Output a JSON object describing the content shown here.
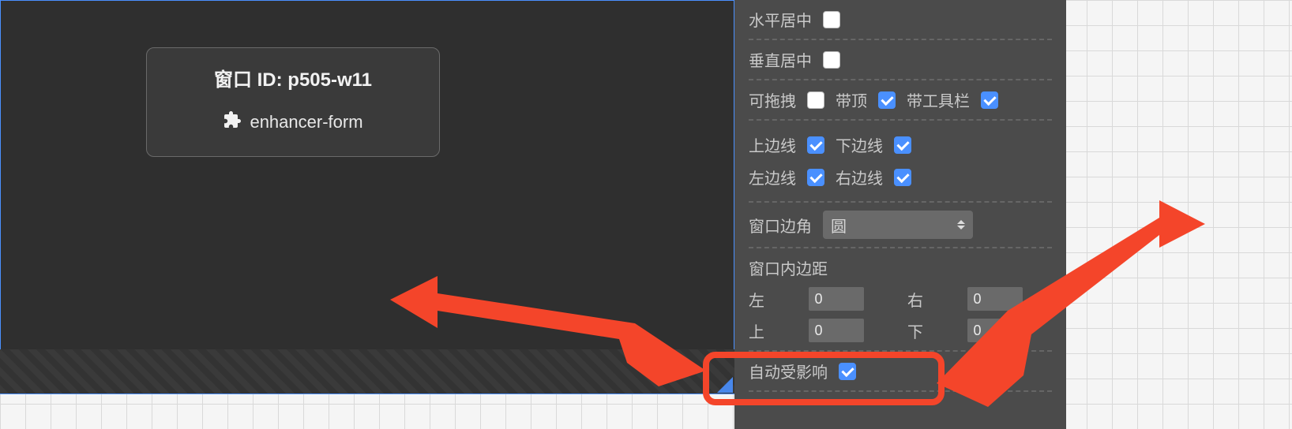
{
  "canvas": {
    "window_card": {
      "title_prefix": "窗口 ID: ",
      "window_id": "p505-w11",
      "component_label": "enhancer-form",
      "icon_name": "puzzle-icon"
    },
    "add_button_label": "+"
  },
  "panel": {
    "rows": {
      "h_center": {
        "label": "水平居中",
        "checked": false
      },
      "v_center": {
        "label": "垂直居中",
        "checked": false
      },
      "draggable": {
        "label": "可拖拽",
        "checked": false
      },
      "with_top": {
        "label": "带顶",
        "checked": true
      },
      "with_toolbar": {
        "label": "带工具栏",
        "checked": true
      },
      "border_top": {
        "label": "上边线",
        "checked": true
      },
      "border_bottom": {
        "label": "下边线",
        "checked": true
      },
      "border_left": {
        "label": "左边线",
        "checked": true
      },
      "border_right": {
        "label": "右边线",
        "checked": true
      },
      "corner": {
        "label": "窗口边角",
        "value": "圆"
      },
      "padding": {
        "label": "窗口内边距",
        "left_label": "左",
        "left": "0",
        "right_label": "右",
        "right": "0",
        "top_label": "上",
        "top": "0",
        "bottom_label": "下",
        "bottom": "0"
      },
      "auto_affect": {
        "label": "自动受影响",
        "checked": true
      }
    }
  },
  "colors": {
    "accent": "#4a90ff",
    "annotation": "#f4452a"
  }
}
